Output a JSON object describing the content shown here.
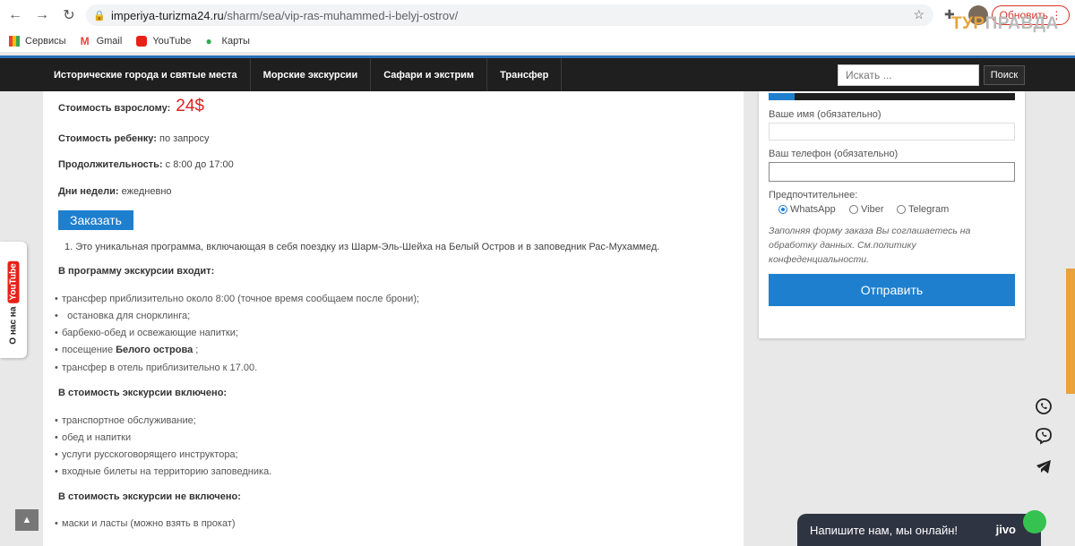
{
  "browser": {
    "url_domain": "imperiya-turizma24.ru",
    "url_path": "/sharm/sea/vip-ras-muhammed-i-belyj-ostrov/",
    "update_label": "Обновить",
    "bookmarks": [
      "Сервисы",
      "Gmail",
      "YouTube",
      "Карты"
    ]
  },
  "watermark": {
    "part1": "ТУР",
    "part2": "ПРАВДА"
  },
  "nav": {
    "items": [
      "Исторические города и святые места",
      "Морские экскурсии",
      "Сафари и экстрим",
      "Трансфер"
    ],
    "search_placeholder": "Искать ...",
    "search_button": "Поиск"
  },
  "content": {
    "adult_label": "Стоимость взрослому:",
    "adult_price": "24$",
    "child_label": "Стоимость ребенку:",
    "child_value": "по запросу",
    "duration_label": "Продолжительность:",
    "duration_value": "с 8:00 до 17:00",
    "days_label": "Дни недели:",
    "days_value": "ежедневно",
    "order_button": "Заказать",
    "intro": "1. Это уникальная программа, включающая в себя поездку из Шарм-Эль-Шейха на Белый Остров и в заповедник Рас-Мухаммед.",
    "program_heading": "В программу экскурсии входит:",
    "program_items": [
      "трансфер приблизительно около 8:00 (точное время сообщаем после брони);",
      "  остановка для снорклинга;",
      "барбекю-обед и освежающие напитки;",
      "посещение",
      "трансфер в отель приблизительно к 17.00."
    ],
    "program_bold": "Белого острова",
    "program_bold_suffix": " ;",
    "included_heading": "В стоимость экскурсии включено:",
    "included_items": [
      "транспортное обслуживание;",
      "обед и напитки",
      "услуги русскоговорящего инструктора;",
      "входные билеты на территорию заповедника."
    ],
    "excluded_heading": "В стоимость экскурсии не включено:",
    "excluded_items": [
      "маски и ласты (можно взять в прокат)"
    ]
  },
  "form": {
    "name_label": "Ваше имя (обязательно)",
    "phone_label": "Ваш телефон (обязательно)",
    "pref_label": "Предпочтительнее:",
    "options": [
      "WhatsApp",
      "Viber",
      "Telegram"
    ],
    "selected": "WhatsApp",
    "policy": "Заполняя форму заказа Вы соглашаетесь на обработку данных. См.политику конфеденциальности.",
    "submit": "Отправить"
  },
  "youtube_tab": {
    "text": "О нас на",
    "logo": "YouTube"
  },
  "chat": {
    "text": "Напишите нам, мы онлайн!",
    "brand": "jivo"
  },
  "colors": {
    "accent": "#1e7fcf",
    "price": "#e02020",
    "nav_bg": "#1f1f1f",
    "chat_bg": "#2f3442"
  }
}
